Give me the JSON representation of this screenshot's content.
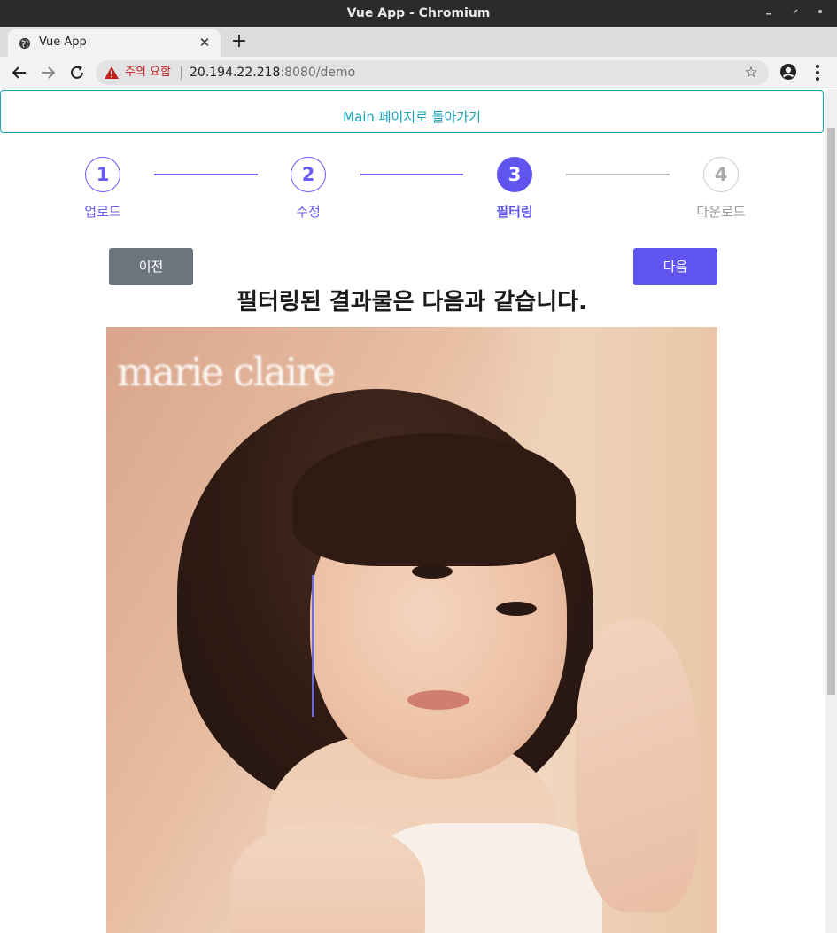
{
  "window": {
    "title": "Vue App - Chromium",
    "controls": [
      "minimize-icon",
      "restore-icon",
      "close-icon"
    ]
  },
  "tabs": [
    {
      "title": "Vue App",
      "icon": "globe-icon"
    }
  ],
  "toolbar": {
    "security_warning": "주의 요함",
    "url_host": "20.194.22.218",
    "url_rest": ":8080/demo"
  },
  "page": {
    "main_link": "Main 페이지로 돌아가기",
    "steps": [
      {
        "number": "1",
        "label": "업로드",
        "state": "complete"
      },
      {
        "number": "2",
        "label": "수정",
        "state": "complete"
      },
      {
        "number": "3",
        "label": "필터링",
        "state": "active"
      },
      {
        "number": "4",
        "label": "다운로드",
        "state": "pending"
      }
    ],
    "prev_button": "이전",
    "next_button": "다음",
    "result_heading": "필터링된 결과물은 다음과 같습니다.",
    "result_image": {
      "logo_text": "marie claire"
    }
  },
  "colors": {
    "accent": "#5f55ee",
    "link": "#17a2b8",
    "secondary": "#6c757d",
    "warning": "#c5221f"
  }
}
